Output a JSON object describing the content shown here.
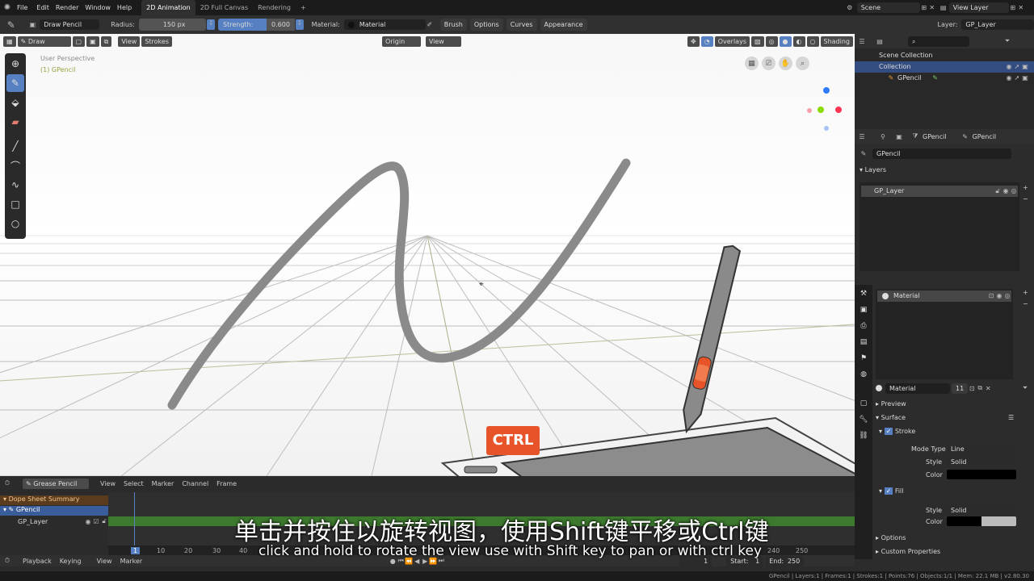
{
  "topbar": {
    "menus": [
      "File",
      "Edit",
      "Render",
      "Window",
      "Help"
    ],
    "tabs": [
      "2D Animation",
      "2D Full Canvas",
      "Rendering",
      "+"
    ],
    "scene": "Scene",
    "view_layer": "View Layer"
  },
  "toolhdr": {
    "brush": "Draw Pencil",
    "radius_label": "Radius:",
    "radius_value": "150 px",
    "strength_label": "Strength:",
    "strength_value": "0.600",
    "material_label": "Material:",
    "material_value": "Material",
    "menus": [
      "Brush",
      "Options",
      "Curves",
      "Appearance"
    ],
    "layer_label": "Layer:",
    "layer_value": "GP_Layer"
  },
  "vphdr": {
    "mode": "Draw",
    "view": "View",
    "strokes": "Strokes",
    "origin": "Origin",
    "view_menu": "View",
    "overlays": "Overlays",
    "shading": "Shading"
  },
  "viewport": {
    "perspective": "User Perspective",
    "object": "(1) GPencil"
  },
  "outliner": {
    "items": [
      "Scene Collection",
      "Collection",
      "GPencil"
    ]
  },
  "props": {
    "tabs": [
      "GPencil",
      "GPencil"
    ],
    "data_name": "GPencil",
    "layers_header": "Layers",
    "layer_item": "GP_Layer",
    "material_item": "Material",
    "material_slot": "Material",
    "material_users": "11",
    "preview": "Preview",
    "surface": "Surface",
    "stroke": "Stroke",
    "mode_type_label": "Mode Type",
    "mode_type_value": "Line",
    "style_label": "Style",
    "style_value": "Solid",
    "color_label": "Color",
    "fill": "Fill",
    "fill_style_value": "Solid",
    "options": "Options",
    "custom_props": "Custom Properties"
  },
  "timeline": {
    "editor": "Grease Pencil",
    "menus": [
      "View",
      "Select",
      "Marker",
      "Channel",
      "Frame"
    ],
    "channels": [
      "Dope Sheet Summary",
      "GPencil",
      "GP_Layer"
    ],
    "ticks": [
      "1",
      "10",
      "20",
      "30",
      "40",
      "240",
      "250"
    ],
    "playback": "Playback",
    "keying": "Keying",
    "view": "View",
    "marker": "Marker",
    "current": "1",
    "start_label": "Start:",
    "start": "1",
    "end_label": "End:",
    "end": "250"
  },
  "statusbar": "GPencil | Layers:1 | Frames:1 | Strokes:1 | Points:76 | Objects:1/1 | Mem: 22.1 MB | v2.80.30",
  "overlay": {
    "ctrl": "CTRL",
    "subtitle_cn": "单击并按住以旋转视图，使用Shift键平移或Ctrl键",
    "subtitle_en": "click and hold to rotate the view use with Shift key to pan or with ctrl key"
  },
  "colors": {
    "accent": "#5680c2",
    "ctrl_badge": "#e8542a",
    "keyframe_track": "#3d7a2e"
  }
}
